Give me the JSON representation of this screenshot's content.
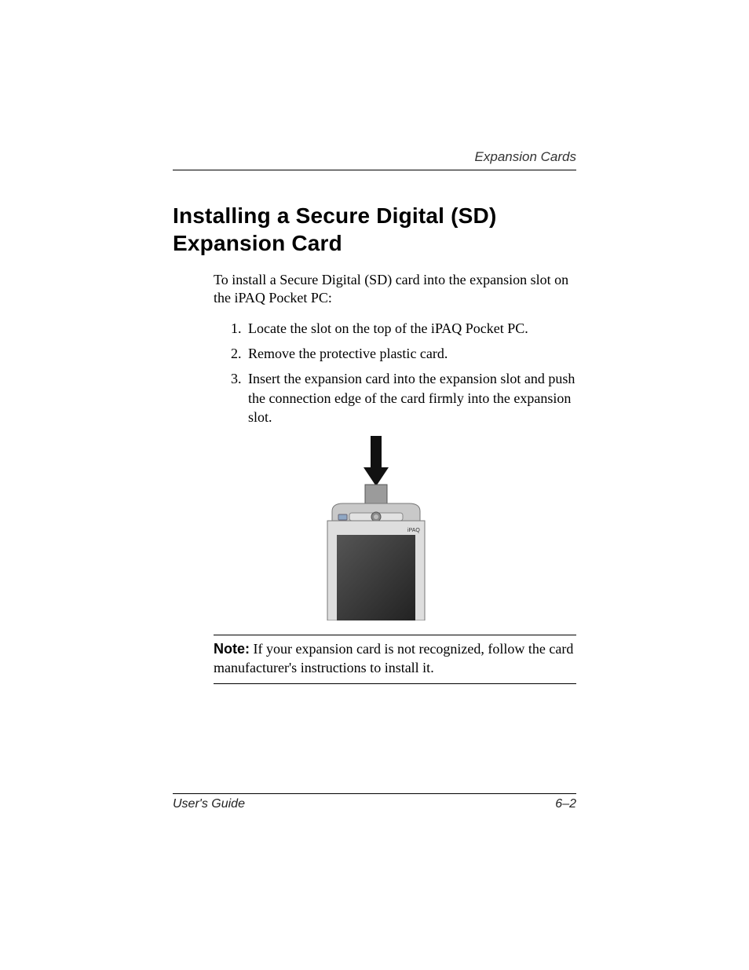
{
  "header": {
    "section_label": "Expansion Cards"
  },
  "heading": "Installing a Secure Digital (SD) Expansion Card",
  "intro": "To install a Secure Digital (SD) card into the expansion slot on the iPAQ Pocket PC:",
  "steps": [
    "Locate the slot on the top of the iPAQ Pocket PC.",
    "Remove the protective plastic card.",
    "Insert the expansion card into the expansion slot and push the connection edge of the card firmly into the expansion slot."
  ],
  "figure": {
    "alt": "iPAQ Pocket PC with arrow showing SD card insertion into top slot",
    "device_label": "iPAQ"
  },
  "note": {
    "label": "Note:",
    "text": "If your expansion card is not recognized, follow the card manufacturer's instructions to install it."
  },
  "footer": {
    "left": "User's Guide",
    "right": "6–2"
  }
}
